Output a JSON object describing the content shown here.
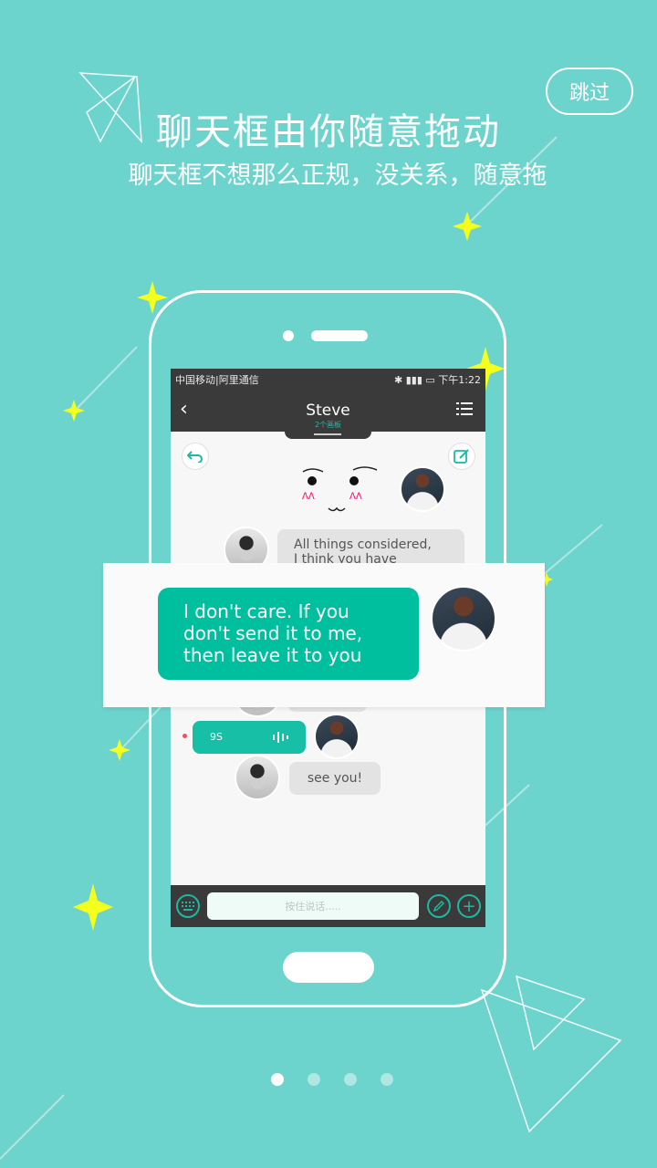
{
  "colors": {
    "background": "#6dd3cd",
    "accent": "#16bfa5",
    "sparkle": "#f4ff1e"
  },
  "skip_label": "跳过",
  "title": "聊天框由你随意拖动",
  "subtitle": "聊天框不想那么正规，没关系，随意拖",
  "phone": {
    "status": {
      "carrier": "中国移动|阿里通信",
      "time": "下午1:22"
    },
    "nav": {
      "back_icon": "chevron-left-icon",
      "title": "Steve",
      "subtitle": "2个画板",
      "menu_icon": "list-icon"
    },
    "messages": {
      "partial_text_1": "All things considered,",
      "partial_text_2": "I think you have",
      "voice_duration": "9S",
      "see_you": "see you!"
    },
    "input_placeholder": "按住说话....."
  },
  "overlay": {
    "lines": [
      "I don't care. If you",
      "don't send it to me,",
      "then leave it to you"
    ]
  },
  "pager": {
    "total": 4,
    "active": 0
  }
}
